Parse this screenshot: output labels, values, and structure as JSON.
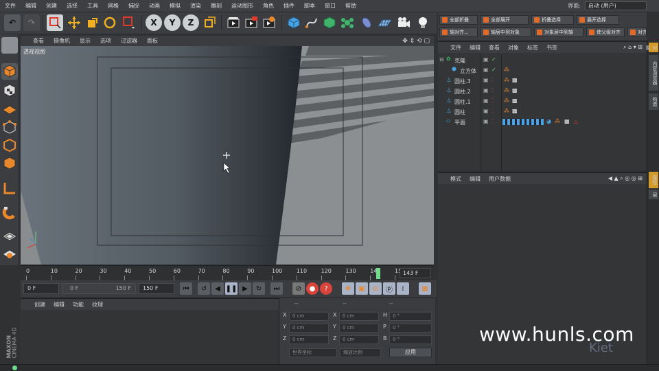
{
  "menubar": {
    "items": [
      "文件",
      "编辑",
      "创建",
      "选择",
      "工具",
      "网格",
      "捕捉",
      "动画",
      "模拟",
      "渲染",
      "雕刻",
      "运动图形",
      "角色",
      "插件",
      "脚本",
      "窗口",
      "帮助"
    ],
    "layout_label": "界面:",
    "layout_value": "启动 (用户)"
  },
  "toolbar": {
    "axis_x": "X",
    "axis_y": "Y",
    "axis_z": "Z"
  },
  "viewport": {
    "menu": [
      "查看",
      "摄像机",
      "显示",
      "选项",
      "过滤器",
      "面板"
    ],
    "label": "透视视图"
  },
  "timeline": {
    "ticks": [
      "0",
      "10",
      "20",
      "30",
      "40",
      "50",
      "60",
      "70",
      "80",
      "90",
      "100",
      "110",
      "120",
      "130",
      "140",
      "150"
    ],
    "current_frame": "143 F",
    "playhead_frame": 143
  },
  "playbar": {
    "start_field": "0 F",
    "range_start": "0 F",
    "range_end": "150 F",
    "end_field": "150 F"
  },
  "material_panel": {
    "menu": [
      "创建",
      "编辑",
      "功能",
      "纹理"
    ]
  },
  "coordinates": {
    "headers": [
      "--",
      "--",
      "--"
    ],
    "rows": [
      {
        "a_label": "X",
        "a_val": "0 cm",
        "b_label": "X",
        "b_val": "0 cm",
        "c_label": "H",
        "c_val": "0 °"
      },
      {
        "a_label": "Y",
        "a_val": "0 cm",
        "b_label": "Y",
        "b_val": "0 cm",
        "c_label": "P",
        "c_val": "0 °"
      },
      {
        "a_label": "Z",
        "a_val": "0 cm",
        "b_label": "Z",
        "b_val": "0 cm",
        "c_label": "B",
        "c_val": "0 °"
      }
    ],
    "mode_select": "世界坐标",
    "scale_select": "缩放比例",
    "apply_button": "应用"
  },
  "right_toolbar": {
    "row1": [
      "全部折叠",
      "全部展开",
      "折叠选择",
      "展开选择"
    ],
    "row2": [
      "轴对齐...",
      "轴居中到对象",
      "对象居中到轴",
      "使父级对齐",
      "对齐到父"
    ]
  },
  "object_manager": {
    "menu": [
      "文件",
      "编辑",
      "查看",
      "对象",
      "标签",
      "书签"
    ],
    "objects": [
      {
        "name": "克隆",
        "indent": 0
      },
      {
        "name": "立方体",
        "indent": 1
      },
      {
        "name": "圆柱.3",
        "indent": 0
      },
      {
        "name": "圆柱.2",
        "indent": 0
      },
      {
        "name": "圆柱.1",
        "indent": 0
      },
      {
        "name": "圆柱",
        "indent": 0
      },
      {
        "name": "平面",
        "indent": 0
      }
    ]
  },
  "attribute_manager": {
    "menu": [
      "模式",
      "编辑",
      "用户数据"
    ]
  },
  "side_tabs": [
    "对象",
    "内容浏览器",
    "构造",
    "属性",
    "层"
  ],
  "branding": {
    "vertical_logo_1": "MAXON",
    "vertical_logo_2": "CINEMA 4D",
    "watermark": "www.hunls.com",
    "watermark_small": "Kiet"
  },
  "colors": {
    "accent_orange": "#e8872c",
    "playhead_green": "#6fdc8c",
    "panel_dark": "#333537"
  }
}
